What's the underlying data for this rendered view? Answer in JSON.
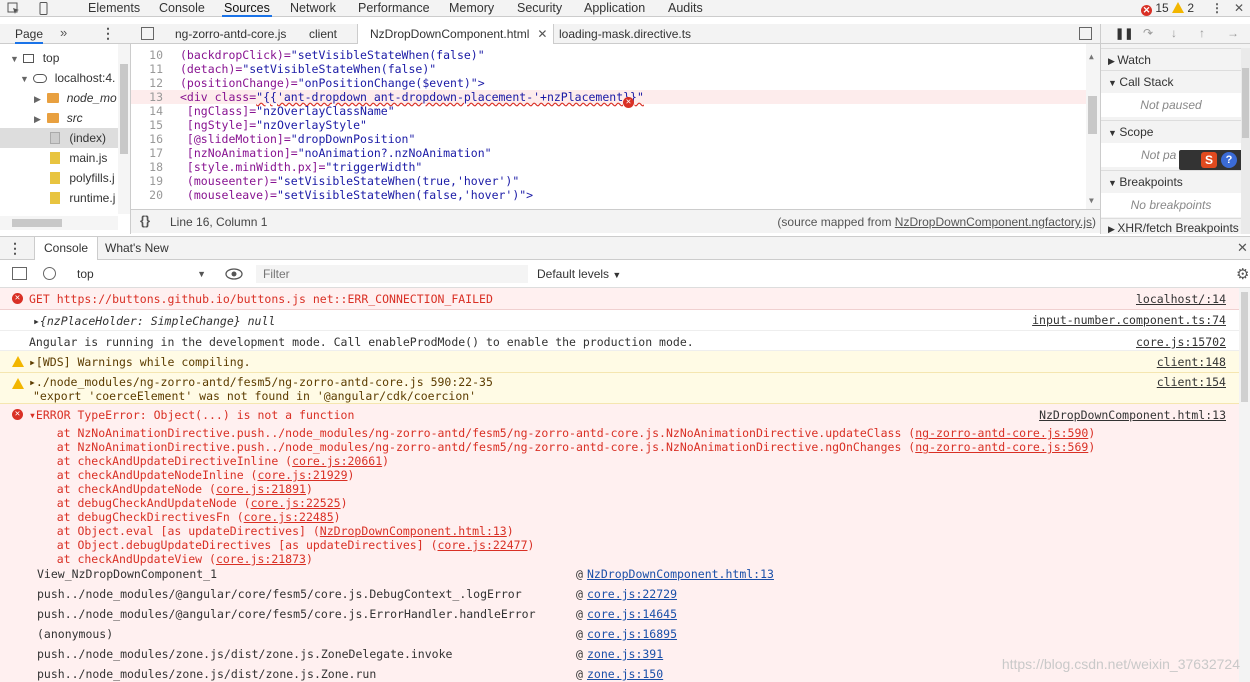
{
  "toolbar": {
    "tabs": [
      "Elements",
      "Console",
      "Sources",
      "Network",
      "Performance",
      "Memory",
      "Security",
      "Application",
      "Audits"
    ],
    "active_tab": "Sources",
    "error_count": "15",
    "warning_count": "2"
  },
  "navigator": {
    "tab": "Page",
    "items": [
      {
        "label": "top"
      },
      {
        "label": "localhost:4."
      },
      {
        "label": "node_mo"
      },
      {
        "label": "src"
      },
      {
        "label": "(index)"
      },
      {
        "label": "main.js"
      },
      {
        "label": "polyfills.j"
      },
      {
        "label": "runtime.j"
      }
    ]
  },
  "editor": {
    "tabs": [
      "ng-zorro-antd-core.js",
      "client",
      "NzDropDownComponent.html",
      "loading-mask.directive.ts"
    ],
    "lines": [
      {
        "n": "10",
        "a": "(backdropClick)=",
        "b": "\"setVisibleStateWhen(false)\""
      },
      {
        "n": "11",
        "a": "(detach)=",
        "b": "\"setVisibleStateWhen(false)\""
      },
      {
        "n": "12",
        "a": "(positionChange)=",
        "b": "\"onPositionChange($event)\">"
      },
      {
        "n": "13",
        "a": "<div class=",
        "b": "\"{{'ant-dropdown ant-dropdown-placement-'+nzPlacement}}\""
      },
      {
        "n": "14",
        "a": " [ngClass]=",
        "b": "\"nzOverlayClassName\""
      },
      {
        "n": "15",
        "a": " [ngStyle]=",
        "b": "\"nzOverlayStyle\""
      },
      {
        "n": "16",
        "a": " [@slideMotion]=",
        "b": "\"dropDownPosition\""
      },
      {
        "n": "17",
        "a": " [nzNoAnimation]=",
        "b": "\"noAnimation?.nzNoAnimation\""
      },
      {
        "n": "18",
        "a": " [style.minWidth.px]=",
        "b": "\"triggerWidth\""
      },
      {
        "n": "19",
        "a": " (mouseenter)=",
        "b": "\"setVisibleStateWhen(true,'hover')\""
      },
      {
        "n": "20",
        "a": " (mouseleave)=",
        "b": "\"setVisibleStateWhen(false,'hover')\">"
      }
    ],
    "status_pos": "Line 16, Column 1",
    "status_src_prefix": "(source mapped from ",
    "status_src_link": "NzDropDownComponent.ngfactory.js",
    "status_src_suffix": ")"
  },
  "debugger": {
    "sections": [
      "Watch",
      "Call Stack",
      "Scope",
      "Breakpoints",
      "XHR/fetch Breakpoints"
    ],
    "call_stack_msg": "Not paused",
    "scope_msg": "Not pa",
    "breakpoints_msg": "No breakpoints"
  },
  "drawer": {
    "tabs": [
      "Console",
      "What's New"
    ],
    "context": "top",
    "filter_placeholder": "Filter",
    "levels": "Default levels"
  },
  "console": {
    "rows": [
      {
        "text": "GET https://buttons.github.io/buttons.js net::ERR_CONNECTION_FAILED",
        "src": "localhost/:14"
      },
      {
        "text": "▸{nzPlaceHolder: SimpleChange} null",
        "src": "input-number.component.ts:74"
      },
      {
        "text": "Angular is running in the development mode. Call enableProdMode() to enable the production mode.",
        "src": "core.js:15702"
      },
      {
        "text": "▸[WDS] Warnings while compiling.",
        "src": "client:148"
      },
      {
        "text": "▸./node_modules/ng-zorro-antd/fesm5/ng-zorro-antd-core.js 590:22-35",
        "text2": "\"export 'coerceElement' was not found in '@angular/cdk/coercion'",
        "src": "client:154"
      },
      {
        "text": "▾ERROR TypeError: Object(...) is not a function",
        "src": "NzDropDownComponent.html:13"
      }
    ],
    "stack": [
      {
        "pre": "    at NzNoAnimationDirective.push../node_modules/ng-zorro-antd/fesm5/ng-zorro-antd-core.js.NzNoAnimationDirective.updateClass (",
        "link": "ng-zorro-antd-core.js:590",
        "post": ")"
      },
      {
        "pre": "    at NzNoAnimationDirective.push../node_modules/ng-zorro-antd/fesm5/ng-zorro-antd-core.js.NzNoAnimationDirective.ngOnChanges (",
        "link": "ng-zorro-antd-core.js:569",
        "post": ")"
      },
      {
        "pre": "    at checkAndUpdateDirectiveInline (",
        "link": "core.js:20661",
        "post": ")"
      },
      {
        "pre": "    at checkAndUpdateNodeInline (",
        "link": "core.js:21929",
        "post": ")"
      },
      {
        "pre": "    at checkAndUpdateNode (",
        "link": "core.js:21891",
        "post": ")"
      },
      {
        "pre": "    at debugCheckAndUpdateNode (",
        "link": "core.js:22525",
        "post": ")"
      },
      {
        "pre": "    at debugCheckDirectivesFn (",
        "link": "core.js:22485",
        "post": ")"
      },
      {
        "pre": "    at Object.eval [as updateDirectives] (",
        "link": "NzDropDownComponent.html:13",
        "post": ")"
      },
      {
        "pre": "    at Object.debugUpdateDirectives [as updateDirectives] (",
        "link": "core.js:22477",
        "post": ")"
      },
      {
        "pre": "    at checkAndUpdateView (",
        "link": "core.js:21873",
        "post": ")"
      }
    ],
    "callstack": [
      {
        "fn": "View_NzDropDownComponent_1",
        "link": "NzDropDownComponent.html:13"
      },
      {
        "fn": "push../node_modules/@angular/core/fesm5/core.js.DebugContext_.logError",
        "link": "core.js:22729"
      },
      {
        "fn": "push../node_modules/@angular/core/fesm5/core.js.ErrorHandler.handleError",
        "link": "core.js:14645"
      },
      {
        "fn": "(anonymous)",
        "link": "core.js:16895"
      },
      {
        "fn": "push../node_modules/zone.js/dist/zone.js.ZoneDelegate.invoke",
        "link": "zone.js:391"
      },
      {
        "fn": "push../node_modules/zone.js/dist/zone.js.Zone.run",
        "link": "zone.js:150"
      }
    ],
    "at_sign": "@"
  },
  "watermark": "https://blog.csdn.net/weixin_37632724"
}
